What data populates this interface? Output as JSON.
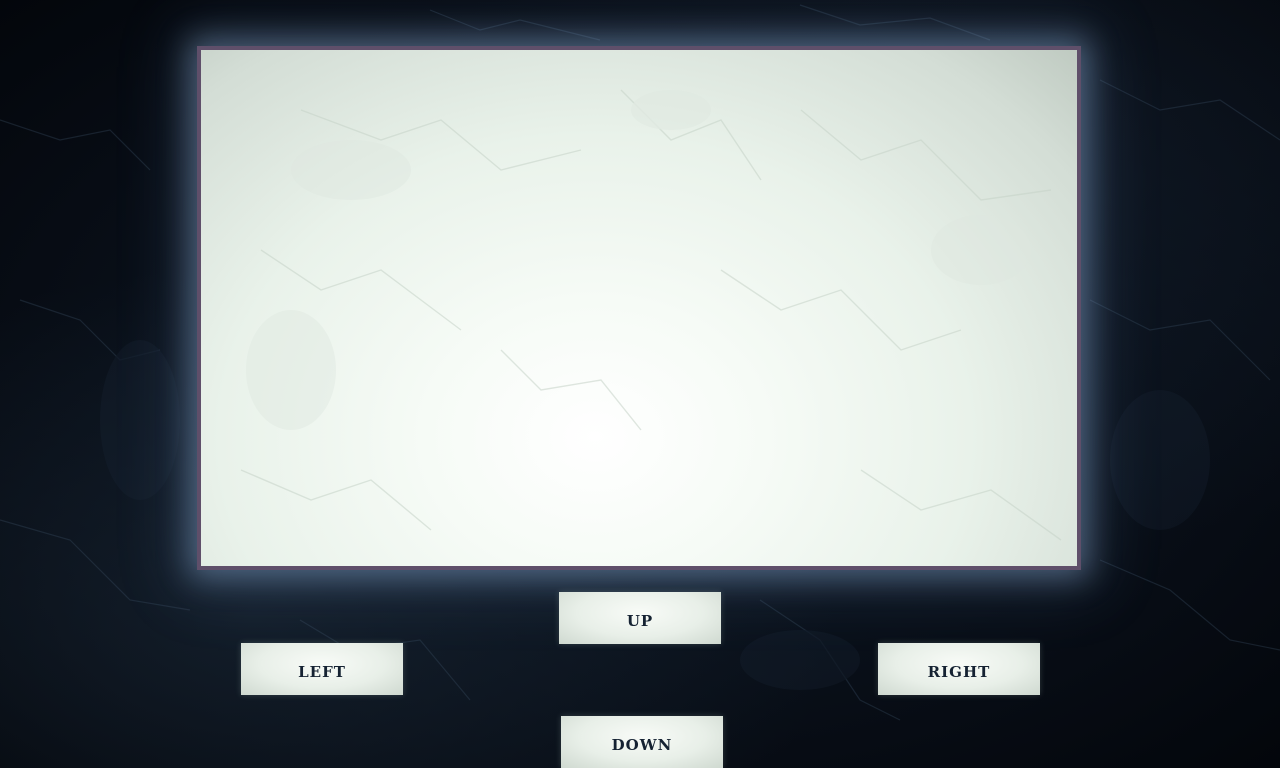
{
  "screen": {
    "frame_color": "#5f4f6a",
    "glow_color": "#aad2ff"
  },
  "controls": {
    "up_label": "UP",
    "left_label": "LEFT",
    "right_label": "RIGHT",
    "down_label": "DOWN"
  },
  "colors": {
    "background": "#070c14",
    "button_face": "#e8efe8",
    "button_text": "#152232"
  }
}
